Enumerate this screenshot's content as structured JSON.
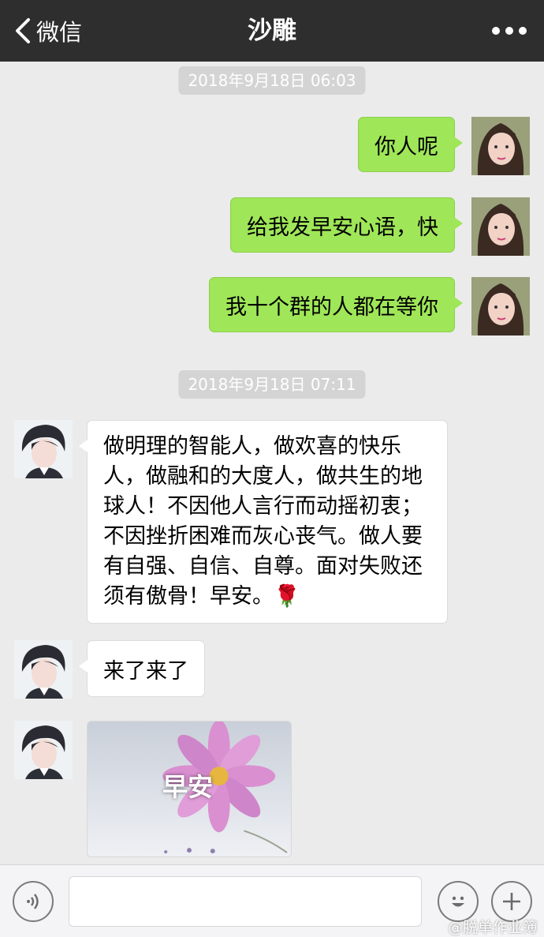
{
  "header": {
    "back_label": "微信",
    "title": "沙雕"
  },
  "messages": [
    {
      "type": "timestamp",
      "text": "2018年9月18日 06:03"
    },
    {
      "type": "sent",
      "text": "你人呢"
    },
    {
      "type": "sent",
      "text": "给我发早安心语，快"
    },
    {
      "type": "sent",
      "text": "我十个群的人都在等你"
    },
    {
      "type": "timestamp",
      "text": "2018年9月18日 07:11"
    },
    {
      "type": "received",
      "text": "做明理的智能人，做欢喜的快乐人，做融和的大度人，做共生的地球人！不因他人言行而动摇初衷；不因挫折困难而灰心丧气。做人要有自强、自信、自尊。面对失败还须有傲骨！早安。🌹"
    },
    {
      "type": "received",
      "text": "来了来了"
    },
    {
      "type": "received_image",
      "caption": "早安"
    }
  ],
  "input": {
    "value": ""
  },
  "icons": {
    "back": "chevron-left-icon",
    "more": "more-dots-icon",
    "voice": "voice-icon",
    "emoji": "emoji-icon",
    "plus": "plus-icon"
  },
  "colors": {
    "topbar": "#2e2e2e",
    "background": "#ebebeb",
    "sent_bubble": "#9fe658",
    "received_bubble": "#ffffff"
  },
  "watermark": "@脱单作业簿"
}
